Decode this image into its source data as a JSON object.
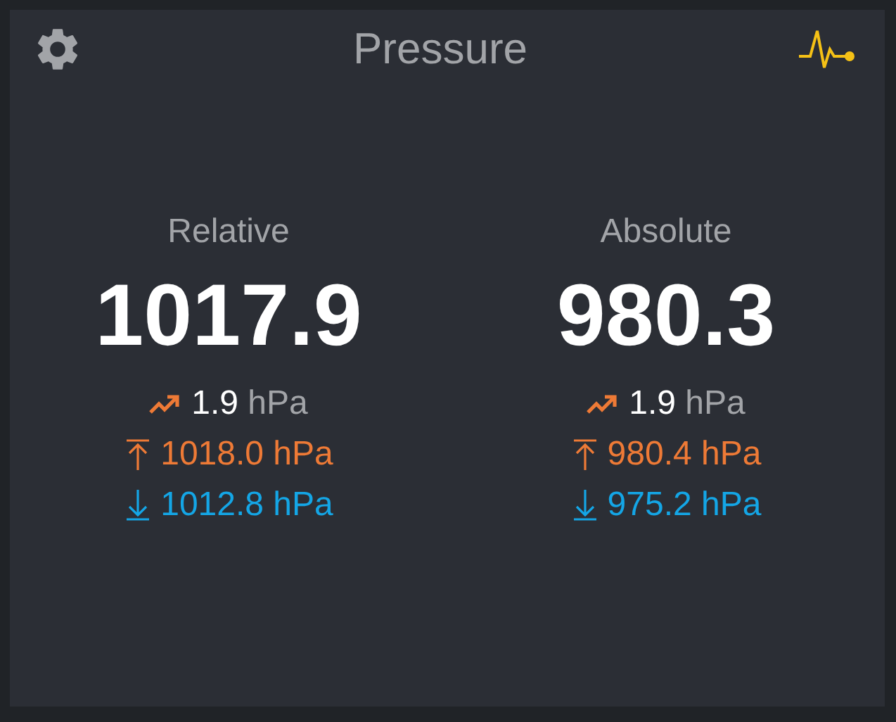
{
  "title": "Pressure",
  "columns": [
    {
      "label": "Relative",
      "value": "1017.9",
      "trend": {
        "value": "1.9",
        "unit": "hPa"
      },
      "max": "1018.0 hPa",
      "min": "1012.8 hPa"
    },
    {
      "label": "Absolute",
      "value": "980.3",
      "trend": {
        "value": "1.9",
        "unit": "hPa"
      },
      "max": "980.4 hPa",
      "min": "975.2 hPa"
    }
  ]
}
